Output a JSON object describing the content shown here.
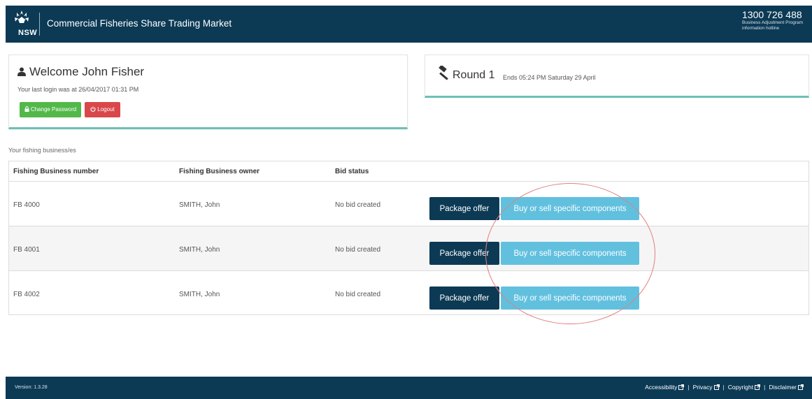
{
  "header": {
    "logo_text": "NSW",
    "title": "Commercial Fisheries Share Trading Market",
    "hotline_number": "1300 726 488",
    "hotline_line1": "Business Adjustment Program",
    "hotline_line2": "information hotline"
  },
  "welcome": {
    "title": "Welcome John Fisher",
    "last_login": "Your last login was at 26/04/2017 01:31 PM",
    "change_password": "Change Password",
    "logout": "Logout"
  },
  "round": {
    "title": "Round 1",
    "ends": "Ends 05:24 PM Saturday 29 April"
  },
  "businesses": {
    "section_label": "Your fishing business/es",
    "columns": [
      "Fishing Business number",
      "Fishing Business owner",
      "Bid status"
    ],
    "rows": [
      {
        "number": "FB 4000",
        "owner": "SMITH, John",
        "status": "No bid created"
      },
      {
        "number": "FB 4001",
        "owner": "SMITH, John",
        "status": "No bid created"
      },
      {
        "number": "FB 4002",
        "owner": "SMITH, John",
        "status": "No bid created"
      }
    ],
    "package_label": "Package offer",
    "specific_label": "Buy or sell specific components"
  },
  "footer": {
    "version": "Version: 1.3.28",
    "links": [
      "Accessibility",
      "Privacy",
      "Copyright",
      "Disclaimer"
    ]
  },
  "colors": {
    "navy": "#0c3a55",
    "teal_accent": "#6cc0b4",
    "green_button": "#52b849",
    "red_button": "#d9474a",
    "light_blue_button": "#62c0df",
    "annotation": "#e0807e"
  }
}
